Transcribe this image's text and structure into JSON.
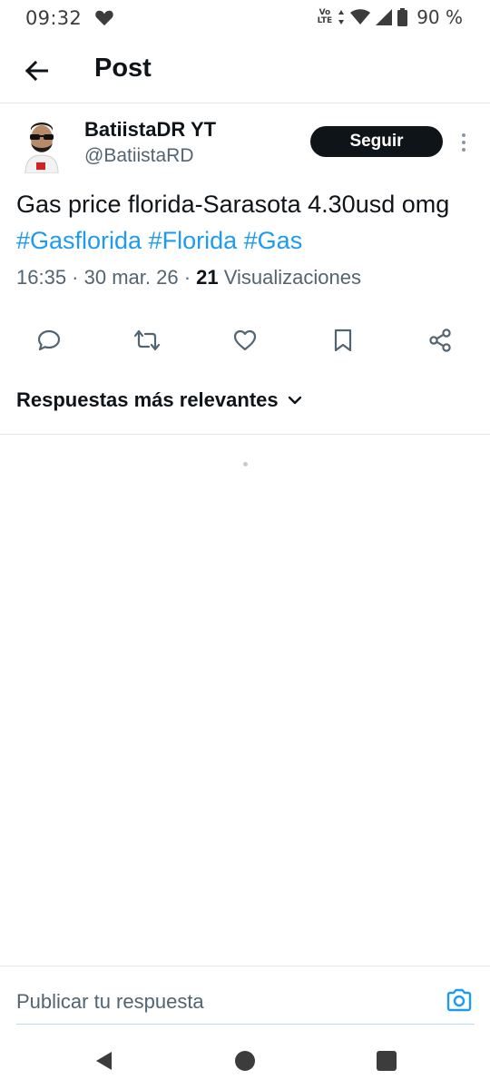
{
  "status_bar": {
    "time": "09:32",
    "volte_top": "Vo",
    "volte_bottom": "LTE",
    "battery": "90 %"
  },
  "header": {
    "title": "Post"
  },
  "tweet": {
    "display_name": "BatiistaDR YT",
    "handle": "@BatiistaRD",
    "follow_label": "Seguir",
    "text": "Gas price florida-Sarasota 4.30usd omg ",
    "hashtags": [
      "#Gasflorida",
      "#Florida",
      "#Gas"
    ],
    "time": "16:35",
    "date": "30 mar. 26",
    "separator": " · ",
    "views_count": "21",
    "views_label": "Visualizaciones"
  },
  "replies": {
    "sort_label": "Respuestas más relevantes"
  },
  "composer": {
    "placeholder": "Publicar tu respuesta"
  },
  "colors": {
    "accent": "#1d9bf0",
    "text_primary": "#0f1419",
    "text_secondary": "#536471"
  },
  "icons": {
    "reply": "reply-icon",
    "repost": "repost-icon",
    "like": "heart-icon",
    "bookmark": "bookmark-icon",
    "share": "share-icon",
    "camera": "camera-icon"
  }
}
